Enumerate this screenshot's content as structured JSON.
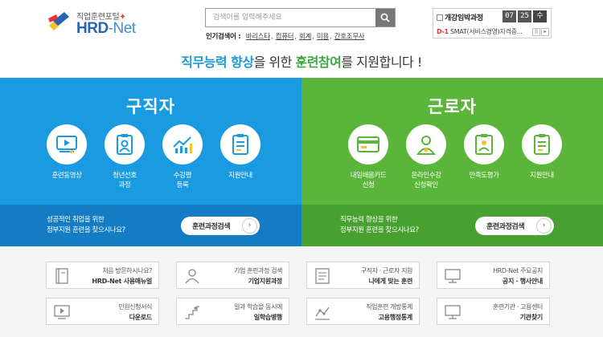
{
  "header": {
    "logo_sub": "직업훈련포털",
    "logo_mark_star": "✦",
    "logo_brand": "HRD",
    "logo_brand_suffix": "-Net",
    "search_placeholder": "검색어를 입력해주세요",
    "popular_label": "인기검색어 :",
    "popular_keywords": [
      "바리스타",
      "컴퓨터",
      "회계",
      "미용",
      "간호조무사"
    ],
    "notice_title": "개강임박과정",
    "date_month": "07",
    "date_day": "25",
    "date_weekday": "수",
    "notice_dday": "D-1",
    "notice_text": "SMAT(서비스경영)자격증...",
    "pager_pause": "||",
    "pager_next": "▸"
  },
  "slogan": {
    "part1": "직무능력 향상",
    "part2": "을 위한 ",
    "part3": "훈련참여",
    "part4": "를 지원합니다 !"
  },
  "jobseeker": {
    "title": "구직자",
    "items": [
      {
        "label": "훈련동영상",
        "icon": "video-icon"
      },
      {
        "label": "청년선호\n과정",
        "icon": "badge-icon"
      },
      {
        "label": "수강평\n등록",
        "icon": "chart-icon"
      },
      {
        "label": "지원안내",
        "icon": "document-icon"
      }
    ],
    "desc": "성공적인 취업을 위한\n정부지원 훈련을 찾으시나요?",
    "cta": "훈련과정검색",
    "cta_arrow": "›"
  },
  "worker": {
    "title": "근로자",
    "items": [
      {
        "label": "내일배움카드\n신청",
        "icon": "card-icon"
      },
      {
        "label": "온라인수강\n신청확인",
        "icon": "person-icon"
      },
      {
        "label": "만족도평가",
        "icon": "id-icon"
      },
      {
        "label": "지원안내",
        "icon": "document-icon"
      }
    ],
    "desc": "직무능력 향상을 위한\n정부지원 훈련을 찾으시나요?",
    "cta": "훈련과정검색",
    "cta_arrow": "›"
  },
  "quick_links": [
    {
      "line1": "처음 방문하시나요?",
      "line2": "HRD-Net 사용매뉴얼",
      "icon": "book-icon"
    },
    {
      "line1": "기업 훈련과정 검색",
      "line2": "기업지원과정",
      "icon": "person-icon"
    },
    {
      "line1": "구직자 · 근로자 지원",
      "line2": "나에게 맞는 훈련",
      "icon": "list-icon"
    },
    {
      "line1": "HRD-Net 주요공지",
      "line2": "공지 · 행사안내",
      "icon": "monitor-icon"
    },
    {
      "line1": "민원신청서식",
      "line2": "다운로드",
      "icon": "video-icon"
    },
    {
      "line1": "일과 학습을 동시에",
      "line2": "일학습병행",
      "icon": "stairs-icon"
    },
    {
      "line1": "직업훈련 개방통계",
      "line2": "고용행정통계",
      "icon": "stats-icon"
    },
    {
      "line1": "훈련기관 · 고용센터",
      "line2": "기관찾기",
      "icon": "monitor-icon"
    }
  ],
  "colors": {
    "jobseeker_panel": "#1a9ae0",
    "worker_panel": "#5ab53a",
    "brand_blue": "#2a62b8",
    "accent_red": "#e5323b"
  }
}
